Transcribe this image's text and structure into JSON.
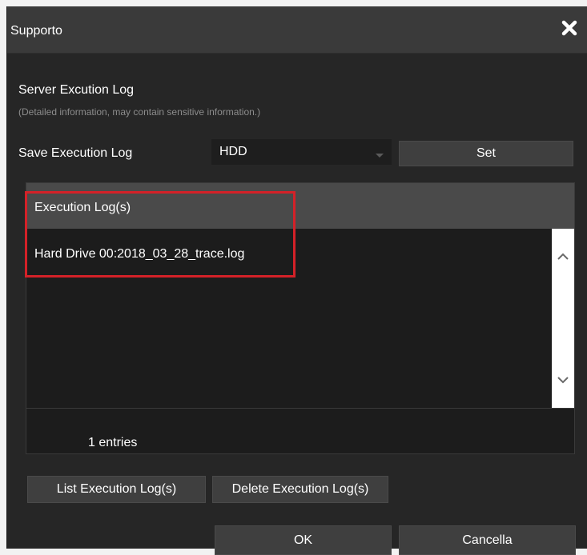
{
  "dialog": {
    "title": "Supporto",
    "close_icon": "close-x-icon"
  },
  "server_log": {
    "title": "Server Excution Log",
    "subtitle": "(Detailed information, may contain sensitive information.)"
  },
  "save_log": {
    "label": "Save Execution Log",
    "selected": "HDD",
    "set_label": "Set"
  },
  "log_list": {
    "header": "Execution Log(s)",
    "items": [
      "Hard Drive 00:2018_03_28_trace.log"
    ],
    "entries": "1 entries"
  },
  "actions": {
    "list_label": "List Execution Log(s)",
    "delete_label": "Delete Execution Log(s)",
    "ok_label": "OK",
    "cancel_label": "Cancella"
  },
  "colors": {
    "highlight": "#d42128",
    "panel_bg": "#262626",
    "titlebar_bg": "#3a3a3a"
  }
}
